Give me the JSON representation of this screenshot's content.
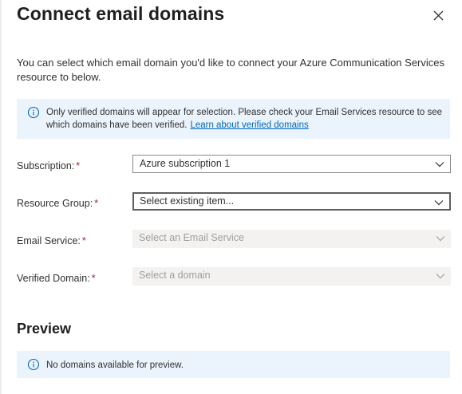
{
  "panel": {
    "title": "Connect email domains",
    "close_icon": "close-icon",
    "intro": "You can select which email domain you'd like to connect your Azure Communication Services resource to below."
  },
  "info_notice": {
    "icon": "info-icon",
    "text": "Only verified domains will appear for selection. Please check your Email Services resource to see which domains have been verified.",
    "link_text": "Learn about verified domains"
  },
  "form": {
    "required_marker": "*",
    "subscription": {
      "label": "Subscription:",
      "value": "Azure subscription 1"
    },
    "resource_group": {
      "label": "Resource Group:",
      "placeholder": "Select existing item..."
    },
    "email_service": {
      "label": "Email Service:",
      "placeholder": "Select an Email Service"
    },
    "verified_domain": {
      "label": "Verified Domain:",
      "placeholder": "Select a domain"
    }
  },
  "preview": {
    "title": "Preview",
    "icon": "info-icon",
    "message": "No domains available for preview."
  },
  "colors": {
    "info_background": "#ebf3fc",
    "info_icon": "#0067b8",
    "link": "#0067b8",
    "required": "#a4262c",
    "disabled_field": "#f3f2f1"
  }
}
